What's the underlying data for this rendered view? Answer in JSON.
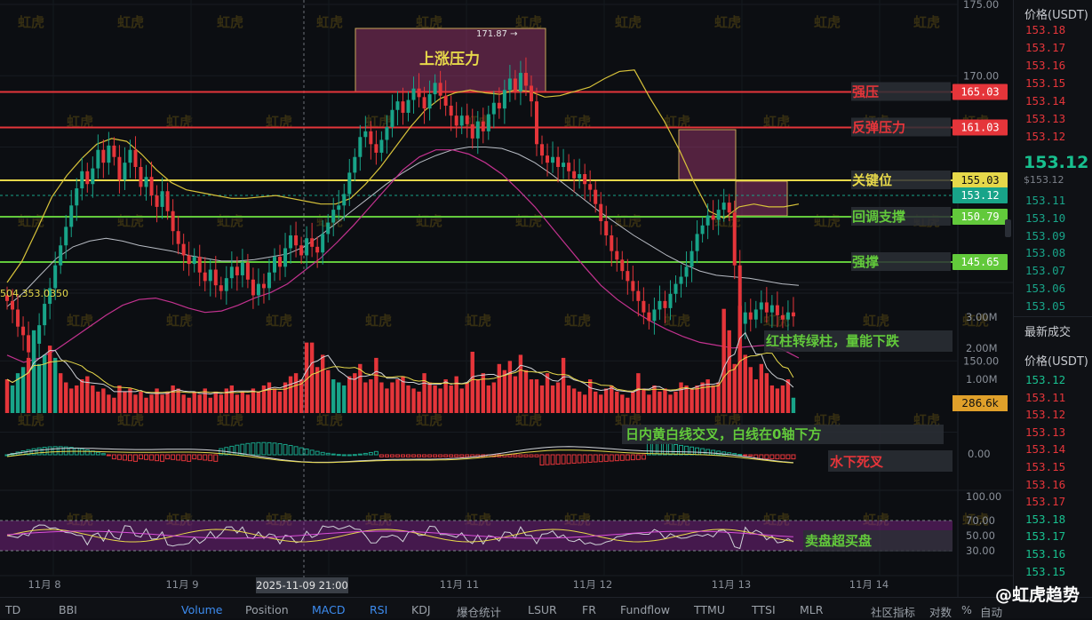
{
  "chart_data": {
    "type": "candlestick",
    "y_axis": {
      "min": 145,
      "max": 175,
      "ticks": [
        175,
        170,
        165,
        160,
        155,
        150,
        145
      ],
      "tick_labels": [
        "175.00",
        "170.00",
        "",
        "160.00",
        "",
        "150.00",
        ""
      ]
    },
    "x_axis": {
      "tick_labels": [
        "11月 8",
        "11月 9",
        "11月 11",
        "11月 12",
        "11月 13",
        "11月 14"
      ],
      "crosshair_label": "2025-11-09 21:00"
    },
    "candles_close": [
      154.2,
      153.6,
      152.4,
      151.8,
      150.6,
      151.2,
      152.5,
      154.0,
      155.1,
      156.7,
      158.1,
      159.4,
      160.9,
      162.1,
      163.3,
      162.4,
      163.5,
      164.8,
      163.9,
      165.1,
      164.3,
      162.7,
      163.9,
      164.8,
      163.6,
      162.2,
      162.9,
      161.6,
      160.8,
      161.9,
      160.5,
      159.1,
      158.2,
      157.4,
      156.8,
      157.3,
      156.2,
      155.6,
      156.4,
      155.3,
      154.9,
      155.8,
      156.6,
      156.0,
      156.9,
      155.7,
      154.6,
      155.4,
      155.1,
      156.2,
      157.3,
      156.6,
      157.9,
      158.8,
      158.1,
      157.4,
      158.6,
      158.0,
      157.6,
      158.9,
      159.7,
      160.6,
      160.9,
      161.7,
      163.2,
      164.3,
      165.7,
      166.1,
      165.2,
      164.6,
      165.5,
      166.4,
      167.6,
      168.2,
      167.4,
      168.3,
      169.1,
      168.5,
      167.7,
      168.7,
      169.5,
      168.6,
      167.9,
      167.2,
      166.5,
      167.2,
      166.6,
      165.6,
      166.8,
      166.1,
      167.3,
      168.1,
      167.7,
      169.0,
      169.8,
      168.9,
      170.2,
      169.3,
      168.2,
      165.2,
      164.4,
      163.9,
      164.3,
      163.6,
      163.9,
      163.3,
      162.8,
      163.1,
      162.4,
      162.0,
      161.0,
      159.8,
      158.8,
      157.7,
      157.1,
      156.3,
      155.6,
      154.9,
      154.2,
      153.4,
      152.8,
      153.6,
      154.2,
      153.7,
      154.7,
      155.4,
      155.9,
      156.6,
      157.7,
      158.9,
      159.5,
      160.2,
      159.9,
      160.6,
      161.1,
      160.4,
      156.7,
      152.6,
      153.4,
      152.9,
      153.6,
      154.1,
      153.4,
      153.9,
      153.2,
      152.9,
      153.4,
      153.12
    ],
    "bollinger": {
      "upper": [
        155.5,
        157,
        159.2,
        161.5,
        163,
        164.2,
        165.2,
        165.6,
        165.4,
        164.5,
        163.4,
        162.5,
        162,
        161.8,
        161.6,
        161.4,
        161.4,
        161.5,
        161.6,
        161.4,
        161.2,
        161,
        161,
        161.4,
        162.4,
        163.6,
        165,
        166.4,
        167.6,
        168.4,
        168.8,
        169,
        168.8,
        168.7,
        169,
        168.9,
        168.5,
        168.6,
        168.9,
        169.2,
        169.8,
        170.3,
        170.4,
        168.5,
        166.8,
        164.8,
        162.5,
        160.5,
        160,
        160.8,
        161,
        160.8,
        160.8,
        161
      ],
      "mid": [
        153.8,
        154.8,
        156,
        157.2,
        158,
        158.4,
        158.6,
        158.4,
        158.1,
        157.9,
        157.7,
        157.4,
        157.2,
        157,
        157,
        157.1,
        157.3,
        157.5,
        158,
        158.8,
        159.7,
        160.6,
        161.5,
        162.4,
        163.2,
        163.9,
        164.4,
        164.8,
        165,
        165,
        164.9,
        164.5,
        163.9,
        163.1,
        162.2,
        161.3,
        160.4,
        159.6,
        158.8,
        158.1,
        157.4,
        156.8,
        156.3,
        156,
        155.9,
        155.8,
        155.6,
        155.4,
        155.3
      ],
      "lower": [
        150.4,
        149.9,
        150.2,
        150.8,
        151.6,
        152.4,
        153.2,
        153.9,
        154.3,
        154.4,
        154.1,
        153.7,
        153.4,
        153.5,
        153.9,
        154.4,
        154.8,
        155.4,
        156.3,
        157.2,
        158.3,
        159.5,
        160.8,
        162.1,
        163.4,
        164.3,
        164.8,
        164.8,
        164.5,
        163.9,
        163.1,
        162,
        160.8,
        159.4,
        158,
        156.6,
        155.3,
        154.3,
        153.5,
        152.8,
        152.2,
        151.7,
        151.3,
        151.1,
        150.9,
        151,
        151.1,
        150.8,
        150.2
      ]
    },
    "levels": [
      {
        "label": "强压",
        "value": "165.03",
        "color": "#e5353a",
        "text_color": "#e5353a"
      },
      {
        "label": "反弹压力",
        "value": "161.03",
        "color": "#e5353a",
        "text_color": "#e5353a"
      },
      {
        "label": "关键位",
        "value": "155.03",
        "color": "#e6d84a",
        "text_color": "#e6d84a"
      },
      {
        "label": "",
        "value": "153.12",
        "color": "#18a489",
        "text_color": "#18a489"
      },
      {
        "label": "回调支撑",
        "value": "150.79",
        "color": "#62c93b",
        "text_color": "#62c93b"
      },
      {
        "label": "强撑",
        "value": "145.65",
        "color": "#62c93b",
        "text_color": "#62c93b"
      }
    ],
    "boxes": [
      {
        "label": "上涨压力",
        "high_marker": "171.87 →"
      },
      {
        "label": ""
      },
      {
        "label": ""
      }
    ],
    "volume": {
      "header": "504,353.0350",
      "ticks": [
        "3.00M",
        "2.00M",
        "1.00M"
      ],
      "current": "286.6k",
      "annotation": "红柱转绿柱，量能下跌",
      "values": [
        1.1,
        0.9,
        1.3,
        1.5,
        1.8,
        2.7,
        1.6,
        1.9,
        2.2,
        1.8,
        1.3,
        1.0,
        0.8,
        0.9,
        1.1,
        1.2,
        0.9,
        0.7,
        0.8,
        0.6,
        0.5,
        0.9,
        0.7,
        0.8,
        0.6,
        0.7,
        0.5,
        0.6,
        0.8,
        0.6,
        0.7,
        0.9,
        0.8,
        0.6,
        0.5,
        0.7,
        0.6,
        0.8,
        0.5,
        0.7,
        0.6,
        0.8,
        0.9,
        0.6,
        0.7,
        0.6,
        0.8,
        0.7,
        0.9,
        1.0,
        0.8,
        0.7,
        1.0,
        1.2,
        1.3,
        1.1,
        2.3,
        2.3,
        1.5,
        1.9,
        1.4,
        1.1,
        1.0,
        0.9,
        1.2,
        1.3,
        1.6,
        1.0,
        1.1,
        1.8,
        1.0,
        0.8,
        1.0,
        1.1,
        1.2,
        0.9,
        0.8,
        0.7,
        1.3,
        1.0,
        0.9,
        0.8,
        1.1,
        0.9,
        1.2,
        0.8,
        1.0,
        2.0,
        1.1,
        1.3,
        0.9,
        1.0,
        1.6,
        1.4,
        1.7,
        1.2,
        1.9,
        1.4,
        1.1,
        1.1,
        0.9,
        1.3,
        0.9,
        1.0,
        1.8,
        0.9,
        0.8,
        0.7,
        0.6,
        1.1,
        0.7,
        0.6,
        0.8,
        0.9,
        0.7,
        0.6,
        0.5,
        0.7,
        1.3,
        0.8,
        0.6,
        0.9,
        0.7,
        0.8,
        0.6,
        0.7,
        1.0,
        0.9,
        0.8,
        0.9,
        1.0,
        1.1,
        0.9,
        1.0,
        3.4,
        2.7,
        1.6,
        3.5,
        1.9,
        1.5,
        1.1,
        1.6,
        1.3,
        0.9,
        0.8,
        0.9,
        1.1,
        0.5
      ]
    },
    "macd": {
      "tick": "0.00",
      "annotation_1": "日内黄白线交叉，白线在0轴下方",
      "annotation_2": "水下死叉"
    },
    "rsi": {
      "ticks": [
        "100.00",
        "70.00",
        "50.00",
        "30.00"
      ],
      "annotation": "卖盘超买盘"
    },
    "watermark": "虹虎"
  },
  "right_panel": {
    "price_header": "价格(USDT)",
    "asks": [
      "153.18",
      "153.17",
      "153.16",
      "153.15",
      "153.14",
      "153.13",
      "153.12"
    ],
    "last_price": "153.12",
    "last_price_sub": "$153.12",
    "bids": [
      "153.11",
      "153.10",
      "153.09",
      "153.08",
      "153.07",
      "153.06",
      "153.05"
    ],
    "trades_title": "最新成交",
    "trades_header": "价格(USDT)",
    "trades": [
      {
        "p": "153.12",
        "c": "#18c08f"
      },
      {
        "p": "153.11",
        "c": "#e5353a"
      },
      {
        "p": "153.12",
        "c": "#e5353a"
      },
      {
        "p": "153.13",
        "c": "#e5353a"
      },
      {
        "p": "153.14",
        "c": "#e5353a"
      },
      {
        "p": "153.15",
        "c": "#e5353a"
      },
      {
        "p": "153.16",
        "c": "#e5353a"
      },
      {
        "p": "153.17",
        "c": "#e5353a"
      },
      {
        "p": "153.18",
        "c": "#18c08f"
      },
      {
        "p": "153.17",
        "c": "#18c08f"
      },
      {
        "p": "153.16",
        "c": "#18c08f"
      },
      {
        "p": "153.15",
        "c": "#18c08f"
      }
    ]
  },
  "bottom_bar": {
    "items": [
      "TD",
      "BBI",
      "Volume",
      "Position",
      "MACD",
      "RSI",
      "KDJ",
      "爆仓统计",
      "LSUR",
      "FR",
      "Fundflow",
      "TTMU",
      "TTSI",
      "MLR",
      "社区指标"
    ],
    "active": [
      "Volume",
      "MACD",
      "RSI"
    ],
    "right_items": [
      "对数",
      "%",
      "自动"
    ]
  },
  "brand": "@虹虎趋势",
  "colors": {
    "up": "#18a489",
    "down": "#e5353a",
    "yellow": "#e6d84a",
    "green": "#62c93b",
    "purple": "#c3328f"
  }
}
